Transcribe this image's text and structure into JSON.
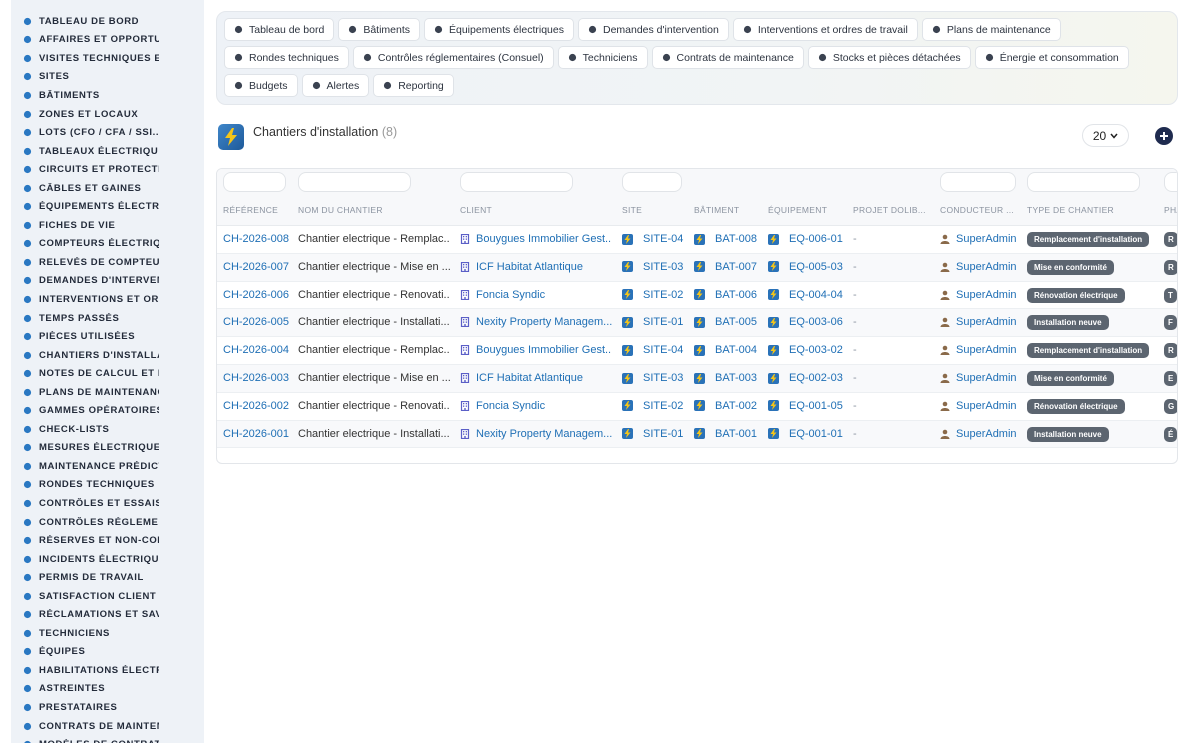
{
  "sidebar": {
    "items": [
      {
        "label": "TABLEAU DE BORD",
        "icon": "dashboard-icon"
      },
      {
        "label": "AFFAIRES ET OPPORTUNITÉS",
        "icon": "target-icon"
      },
      {
        "label": "VISITES TECHNIQUES ET",
        "icon": "clipboard-icon"
      },
      {
        "label": "SITES",
        "icon": "map-pin-icon"
      },
      {
        "label": "BÂTIMENTS",
        "icon": "building-icon"
      },
      {
        "label": "ZONES ET LOCAUX",
        "icon": "door-icon"
      },
      {
        "label": "LOTS (CFO / CFA / SSI...)",
        "icon": "sitemap-icon"
      },
      {
        "label": "TABLEAUX ÉLECTRIQUES",
        "icon": "grid-icon"
      },
      {
        "label": "CIRCUITS ET PROTECTIONS",
        "icon": "plug-icon"
      },
      {
        "label": "CÂBLES ET GAINES",
        "icon": "cable-icon"
      },
      {
        "label": "ÉQUIPEMENTS ÉLECTRIQUES",
        "icon": "cogs-icon"
      },
      {
        "label": "FICHES DE VIE",
        "icon": "history-icon"
      },
      {
        "label": "COMPTEURS ÉLECTRIQUES",
        "icon": "meter-icon"
      },
      {
        "label": "RELEVÉS DE COMPTEURS",
        "icon": "list-icon"
      },
      {
        "label": "DEMANDES D'INTERVENTION",
        "icon": "question-icon"
      },
      {
        "label": "INTERVENTIONS ET ORDRES",
        "icon": "document-icon"
      },
      {
        "label": "TEMPS PASSÉS",
        "icon": "clock-icon"
      },
      {
        "label": "PIÈCES UTILISÉES",
        "icon": "boxes-icon"
      },
      {
        "label": "CHANTIERS D'INSTALLATION",
        "icon": "tools-icon"
      },
      {
        "label": "NOTES DE CALCUL ET ÉTUDES",
        "icon": "calculator-icon"
      },
      {
        "label": "PLANS DE MAINTENANCE",
        "icon": "calendar-icon"
      },
      {
        "label": "GAMMES OPÉRATOIRES",
        "icon": "list-check-icon"
      },
      {
        "label": "CHECK-LISTS",
        "icon": "checklist-icon"
      },
      {
        "label": "MESURES ÉLECTRIQUES",
        "icon": "ruler-icon"
      },
      {
        "label": "MAINTENANCE PRÉDICTIVE",
        "icon": "chart-icon"
      },
      {
        "label": "RONDES TECHNIQUES",
        "icon": "route-icon"
      },
      {
        "label": "CONTRÔLES ET ESSAIS",
        "icon": "search-icon"
      },
      {
        "label": "CONTRÔLES RÉGLEMENTAIRES",
        "icon": "file-check-icon"
      },
      {
        "label": "RÉSERVES ET NON-CONFORMITÉS",
        "icon": "alert-circle-icon"
      },
      {
        "label": "INCIDENTS ÉLECTRIQUES",
        "icon": "warning-icon"
      },
      {
        "label": "PERMIS DE TRAVAIL",
        "icon": "signature-icon"
      },
      {
        "label": "SATISFACTION CLIENT",
        "icon": "smile-icon"
      },
      {
        "label": "RÉCLAMATIONS ET SAV",
        "icon": "comment-icon"
      },
      {
        "label": "TECHNICIENS",
        "icon": "hard-hat-icon"
      },
      {
        "label": "ÉQUIPES",
        "icon": "users-icon"
      },
      {
        "label": "HABILITATIONS ÉLECTRIQUES",
        "icon": "certificate-icon"
      },
      {
        "label": "ASTREINTES",
        "icon": "phone-icon"
      },
      {
        "label": "PRESTATAIRES",
        "icon": "handshake-icon"
      },
      {
        "label": "CONTRATS DE MAINTENANCE",
        "icon": "file-contract-icon"
      },
      {
        "label": "MODÈLES DE CONTRATS",
        "icon": "file-icon"
      }
    ]
  },
  "topmenu": {
    "items": [
      {
        "label": "Tableau de bord",
        "icon": "dashboard-icon"
      },
      {
        "label": "Bâtiments",
        "icon": "building-icon"
      },
      {
        "label": "Équipements électriques",
        "icon": "cogs-icon"
      },
      {
        "label": "Demandes d'intervention",
        "icon": "question-icon"
      },
      {
        "label": "Interventions et ordres de travail",
        "icon": "document-icon"
      },
      {
        "label": "Plans de maintenance",
        "icon": "calendar-icon"
      },
      {
        "label": "Rondes techniques",
        "icon": "route-icon"
      },
      {
        "label": "Contrôles réglementaires (Consuel)",
        "icon": "file-check-icon"
      },
      {
        "label": "Techniciens",
        "icon": "hard-hat-icon"
      },
      {
        "label": "Contrats de maintenance",
        "icon": "file-contract-icon"
      },
      {
        "label": "Stocks et pièces détachées",
        "icon": "boxes-icon"
      },
      {
        "label": "Énergie et consommation",
        "icon": "bolt-icon"
      },
      {
        "label": "Budgets",
        "icon": "money-icon"
      },
      {
        "label": "Alertes",
        "icon": "bell-icon"
      },
      {
        "label": "Reporting",
        "icon": "chart-pie-icon"
      }
    ]
  },
  "page": {
    "title": "Chantiers d'installation",
    "count": "(8)",
    "per_page": "20",
    "logo_icon": "bolt-icon"
  },
  "table": {
    "headers": [
      "RÉFÉRENCE",
      "NOM DU CHANTIER",
      "CLIENT",
      "SITE",
      "BÂTIMENT",
      "ÉQUIPEMENT",
      "PROJET DOLIB...",
      "CONDUCTEUR ...",
      "TYPE DE CHANTIER",
      "PHA"
    ],
    "rows": [
      {
        "ref": "CH-2026-008",
        "name": "Chantier electrique - Remplac...",
        "client": "Bouygues Immobilier Gest...",
        "site": "SITE-04",
        "batiment": "BAT-008",
        "equipement": "EQ-006-01",
        "projet": "-",
        "conducteur": "SuperAdmin",
        "type": "Remplacement d'installation",
        "phase": "R"
      },
      {
        "ref": "CH-2026-007",
        "name": "Chantier electrique - Mise en ...",
        "client": "ICF Habitat Atlantique",
        "site": "SITE-03",
        "batiment": "BAT-007",
        "equipement": "EQ-005-03",
        "projet": "-",
        "conducteur": "SuperAdmin",
        "type": "Mise en conformité",
        "phase": "R"
      },
      {
        "ref": "CH-2026-006",
        "name": "Chantier electrique - Renovati...",
        "client": "Foncia Syndic",
        "site": "SITE-02",
        "batiment": "BAT-006",
        "equipement": "EQ-004-04",
        "projet": "-",
        "conducteur": "SuperAdmin",
        "type": "Rénovation électrique",
        "phase": "T"
      },
      {
        "ref": "CH-2026-005",
        "name": "Chantier electrique - Installati...",
        "client": "Nexity Property Managem...",
        "site": "SITE-01",
        "batiment": "BAT-005",
        "equipement": "EQ-003-06",
        "projet": "-",
        "conducteur": "SuperAdmin",
        "type": "Installation neuve",
        "phase": "F"
      },
      {
        "ref": "CH-2026-004",
        "name": "Chantier electrique - Remplac...",
        "client": "Bouygues Immobilier Gest...",
        "site": "SITE-04",
        "batiment": "BAT-004",
        "equipement": "EQ-003-02",
        "projet": "-",
        "conducteur": "SuperAdmin",
        "type": "Remplacement d'installation",
        "phase": "R"
      },
      {
        "ref": "CH-2026-003",
        "name": "Chantier electrique - Mise en ...",
        "client": "ICF Habitat Atlantique",
        "site": "SITE-03",
        "batiment": "BAT-003",
        "equipement": "EQ-002-03",
        "projet": "-",
        "conducteur": "SuperAdmin",
        "type": "Mise en conformité",
        "phase": "E"
      },
      {
        "ref": "CH-2026-002",
        "name": "Chantier electrique - Renovati...",
        "client": "Foncia Syndic",
        "site": "SITE-02",
        "batiment": "BAT-002",
        "equipement": "EQ-001-05",
        "projet": "-",
        "conducteur": "SuperAdmin",
        "type": "Rénovation électrique",
        "phase": "G"
      },
      {
        "ref": "CH-2026-001",
        "name": "Chantier electrique - Installati...",
        "client": "Nexity Property Managem...",
        "site": "SITE-01",
        "batiment": "BAT-001",
        "equipement": "EQ-001-01",
        "projet": "-",
        "conducteur": "SuperAdmin",
        "type": "Installation neuve",
        "phase": "É"
      }
    ]
  },
  "colors": {
    "sidebar_bg": "#eef2f7",
    "link": "#1f6fb5",
    "badge": "#5c6570",
    "phase_badge": "#5c6570",
    "building_icon": "#5b5fc7",
    "user_icon": "#8a6a4a",
    "entity_icon": "#2a72b8",
    "add_button": "#1f2b4f"
  }
}
